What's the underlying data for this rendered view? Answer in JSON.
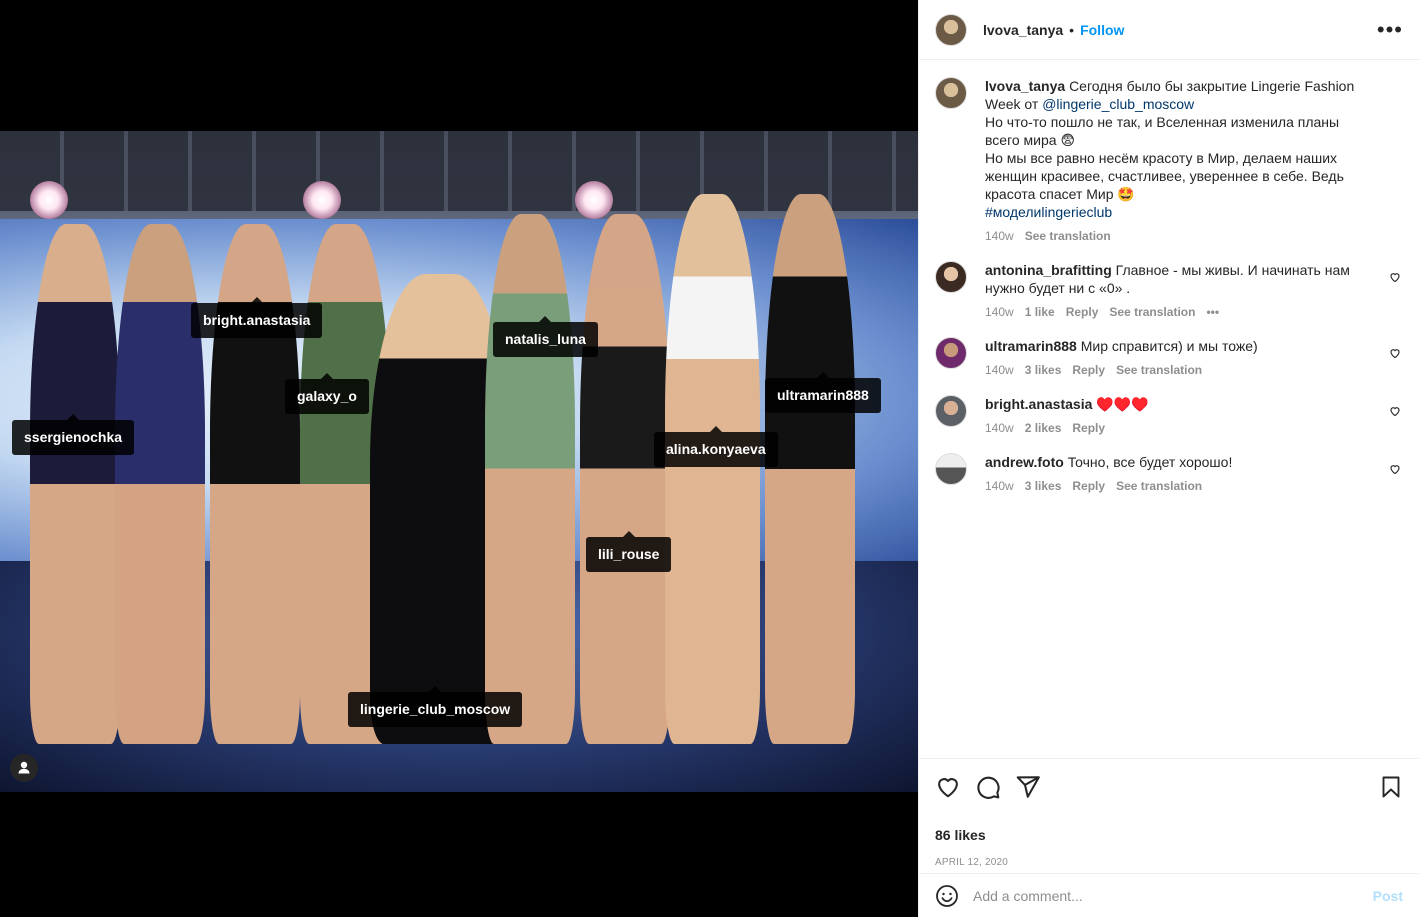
{
  "post": {
    "author": "lvova_tanya",
    "follow_label": "Follow",
    "separator": "•",
    "more_icon": "more-horizontal-icon"
  },
  "media": {
    "tags": [
      {
        "name": "bright.anastasia"
      },
      {
        "name": "natalis_luna"
      },
      {
        "name": "galaxy_o"
      },
      {
        "name": "ultramarin888"
      },
      {
        "name": "ssergienochka"
      },
      {
        "name": "alina.konyaeva"
      },
      {
        "name": "lili_rouse"
      },
      {
        "name": "lingerie_club_moscow"
      }
    ]
  },
  "caption": {
    "author": "lvova_tanya",
    "line1": "Сегодня было бы закрытие Lingerie Fashion Week от",
    "mention": "@lingerie_club_moscow",
    "line2": "Но что-то пошло не так, и Вселенная изменила планы всего мира 😨",
    "line3": "Но мы все равно несём красоту в Мир, делаем наших женщин красивее, счастливее, увереннее в себе. Ведь красота спасет Мир 🤩",
    "hashtag": "#моделиlingerieclub",
    "time": "140w",
    "see_translation": "See translation"
  },
  "comments": [
    {
      "user": "antonina_brafitting",
      "text": "Главное - мы живы. И начинать нам нужно будет ни с «0» .",
      "time": "140w",
      "likes": "1 like",
      "reply": "Reply",
      "translate": "See translation",
      "more": "•••"
    },
    {
      "user": "ultramarin888",
      "text": "Мир справится) и мы тоже)",
      "time": "140w",
      "likes": "3 likes",
      "reply": "Reply",
      "translate": "See translation"
    },
    {
      "user": "bright.anastasia",
      "text": "♥️♥️♥️",
      "time": "140w",
      "likes": "2 likes",
      "reply": "Reply"
    },
    {
      "user": "andrew.foto",
      "text": "Точно, все будет хорошо!",
      "time": "140w",
      "likes": "3 likes",
      "reply": "Reply",
      "translate": "See translation"
    }
  ],
  "actions": {
    "likes": "86 likes",
    "date": "APRIL 12, 2020"
  },
  "add_comment": {
    "placeholder": "Add a comment...",
    "post_label": "Post"
  }
}
